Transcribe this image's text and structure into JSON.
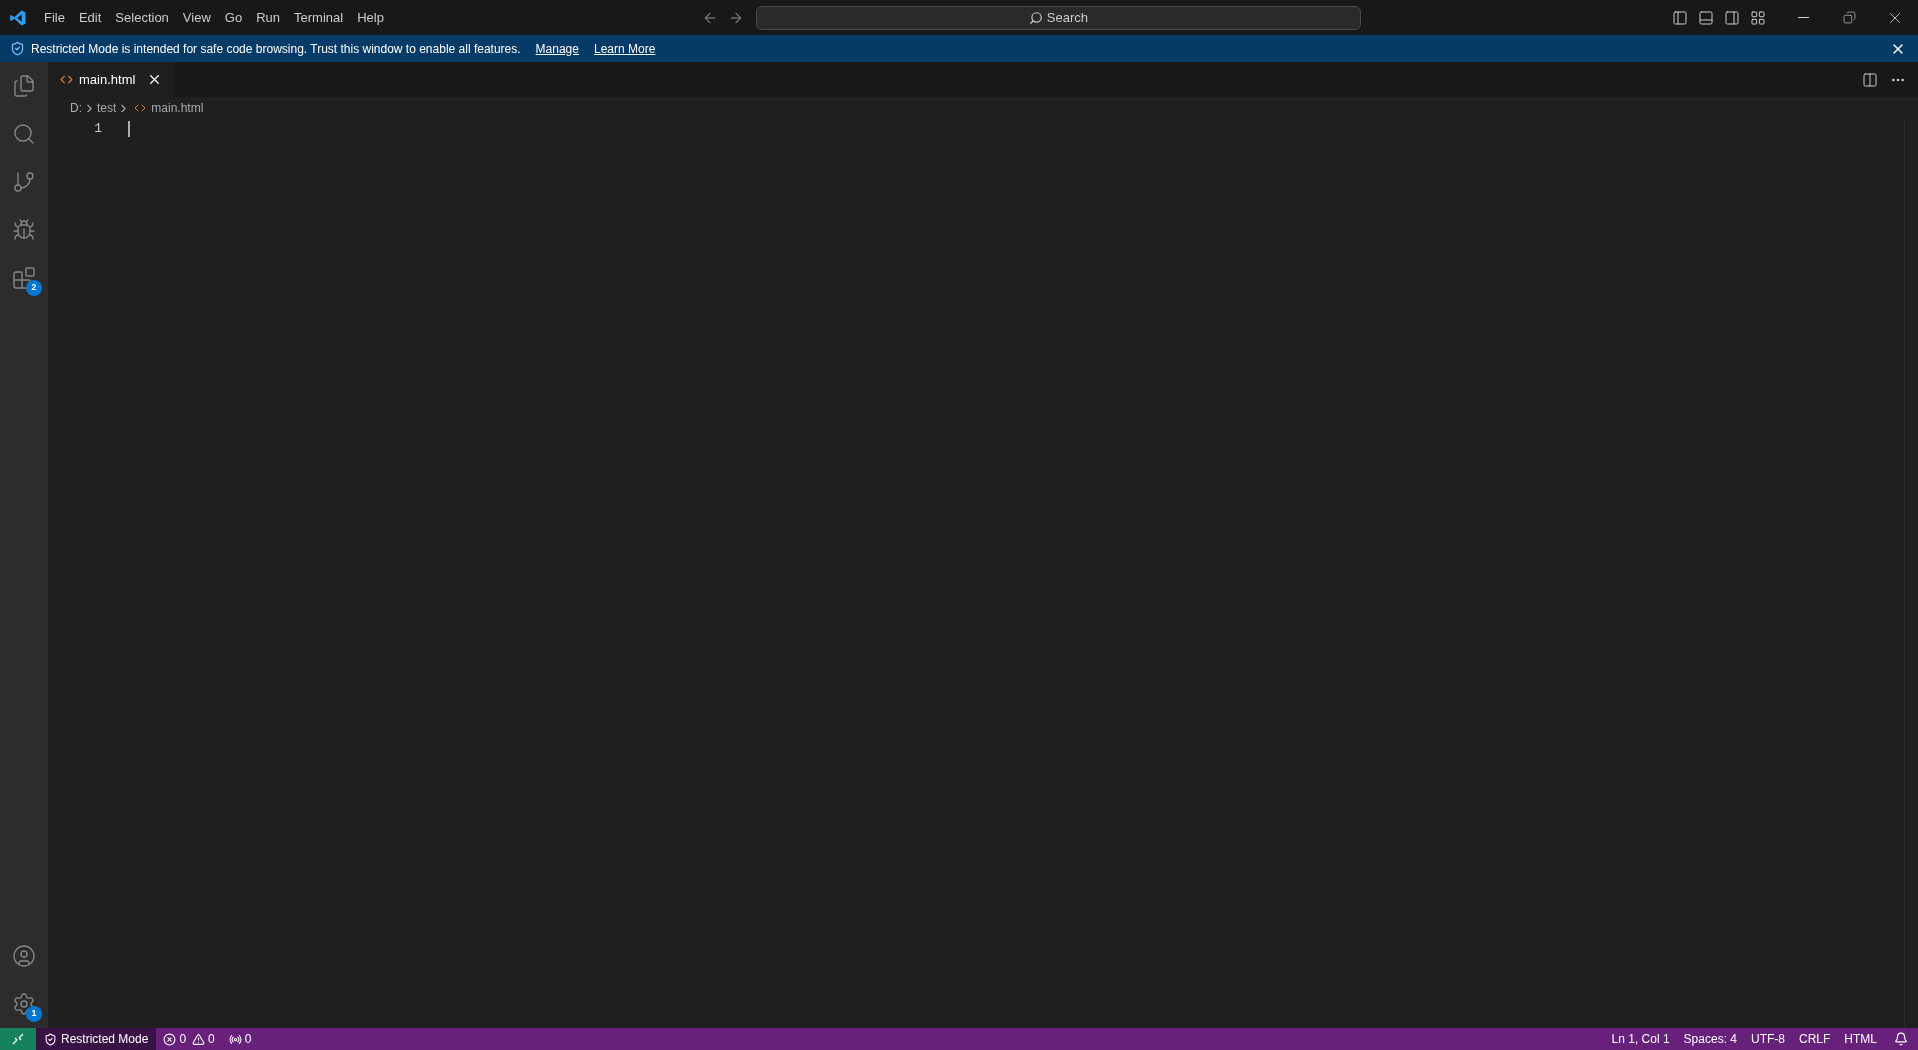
{
  "title_bar": {
    "menu": [
      "File",
      "Edit",
      "Selection",
      "View",
      "Go",
      "Run",
      "Terminal",
      "Help"
    ],
    "search": {
      "label": "Search"
    }
  },
  "banner": {
    "message": "Restricted Mode is intended for safe code browsing. Trust this window to enable all features.",
    "links": [
      "Manage",
      "Learn More"
    ]
  },
  "activity_bar": {
    "items": [
      {
        "kind": "explorer"
      },
      {
        "kind": "search"
      },
      {
        "kind": "source-control"
      },
      {
        "kind": "run"
      },
      {
        "kind": "extensions",
        "badge": "2"
      }
    ],
    "bottom": [
      {
        "kind": "accounts"
      },
      {
        "kind": "settings",
        "badge": "1"
      }
    ]
  },
  "tabs": [
    {
      "label": "main.html",
      "selected": true
    }
  ],
  "breadcrumb": [
    {
      "kind": "folder",
      "label": "D:"
    },
    {
      "kind": "folder",
      "label": "test"
    },
    {
      "kind": "file",
      "label": "main.html"
    }
  ],
  "editor": {
    "line_numbers": [
      "1"
    ]
  },
  "status_bar": {
    "mode": "Restricted Mode",
    "errors": "0",
    "warnings": "0",
    "ports": "0",
    "right": [
      "Ln 1, Col 1",
      "Spaces: 4",
      "UTF-8",
      "CRLF",
      "HTML"
    ]
  }
}
